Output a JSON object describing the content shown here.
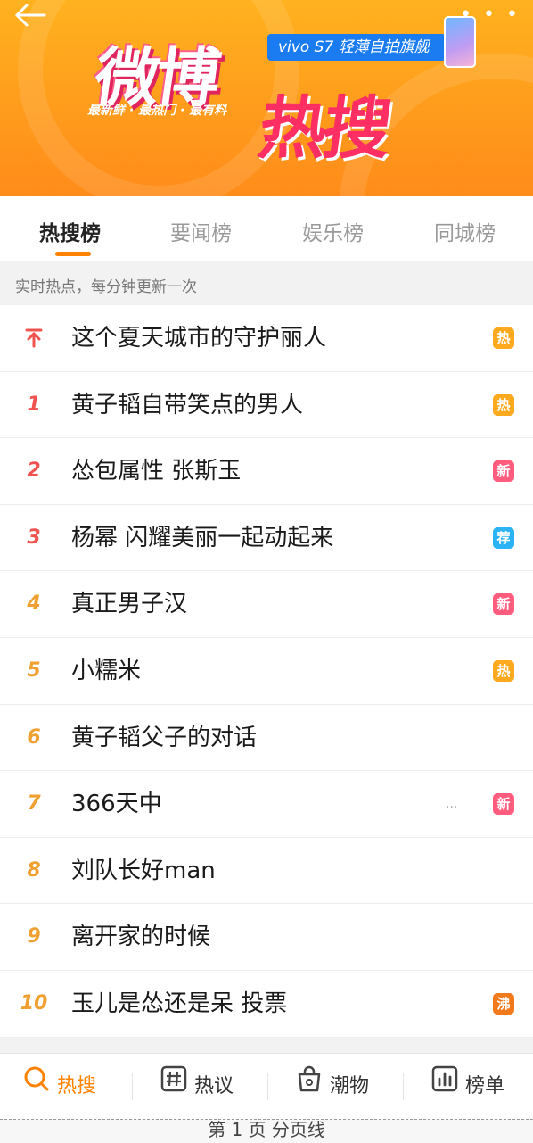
{
  "banner": {
    "more": "• • •",
    "logo_weibo": "微博",
    "logo_resou": "热搜",
    "slogan": "最新鲜 · 最热门 · 最有料",
    "ad_text": "vivo S7 轻薄自拍旗舰"
  },
  "tabs": [
    "热搜榜",
    "要闻榜",
    "娱乐榜",
    "同城榜"
  ],
  "hint": "实时热点，每分钟更新一次",
  "colors": {
    "accent": "#ff8200",
    "rank_red": "#f0524f",
    "rank_orange": "#f0a030",
    "badge_hot": "#ffa91e",
    "badge_new": "#ff5c7e",
    "badge_rec": "#2bb3f5",
    "badge_boil": "#f27a1d"
  },
  "list": [
    {
      "rank": "↑",
      "title": "这个夏天城市的守护丽人",
      "badge": "热",
      "badge_type": "hot",
      "icon": "pin-arrow-icon"
    },
    {
      "rank": "1",
      "title": "黄子韬自带笑点的男人",
      "badge": "热",
      "badge_type": "hot"
    },
    {
      "rank": "2",
      "title": "怂包属性 张斯玉",
      "badge": "新",
      "badge_type": "new"
    },
    {
      "rank": "3",
      "title": "杨幂 闪耀美丽一起动起来",
      "badge": "荐",
      "badge_type": "rec"
    },
    {
      "rank": "4",
      "title": "真正男子汉",
      "badge": "新",
      "badge_type": "new"
    },
    {
      "rank": "5",
      "title": "小糯米",
      "badge": "热",
      "badge_type": "hot"
    },
    {
      "rank": "6",
      "title": "黄子韬父子的对话",
      "badge": "",
      "badge_type": ""
    },
    {
      "rank": "7",
      "title": "366天中",
      "badge": "新",
      "badge_type": "new",
      "extra": "..."
    },
    {
      "rank": "8",
      "title": "刘队长好man",
      "badge": "",
      "badge_type": ""
    },
    {
      "rank": "9",
      "title": "离开家的时候",
      "badge": "",
      "badge_type": ""
    },
    {
      "rank": "10",
      "title": "玉儿是怂还是呆 投票",
      "badge": "沸",
      "badge_type": "boil"
    }
  ],
  "bottom_nav": [
    {
      "label": "热搜",
      "icon": "search-icon"
    },
    {
      "label": "热议",
      "icon": "hashtag-icon"
    },
    {
      "label": "潮物",
      "icon": "shopping-bag-icon"
    },
    {
      "label": "榜单",
      "icon": "chart-icon"
    }
  ],
  "pager": "第 1 页  分页线"
}
